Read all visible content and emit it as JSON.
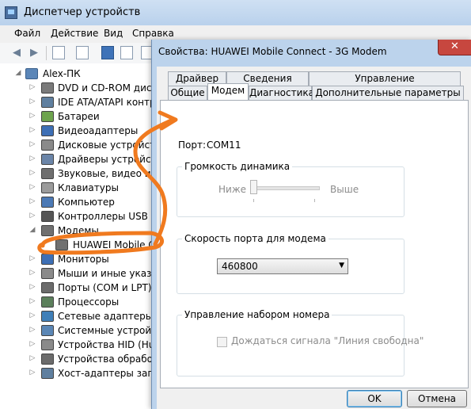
{
  "device_manager": {
    "title": "Диспетчер устройств",
    "menu": [
      "Файл",
      "Действие",
      "Вид",
      "Справка"
    ],
    "tree": {
      "root": "Alex-ПК",
      "items": [
        {
          "label": "DVD и CD-ROM дисково",
          "icon": "dvd-drive-icon",
          "color": "#7a7a7a"
        },
        {
          "label": "IDE ATA/ATAPI контрол",
          "icon": "ide-controller-icon",
          "color": "#5f7f9f"
        },
        {
          "label": "Батареи",
          "icon": "battery-icon",
          "color": "#6da34d"
        },
        {
          "label": "Видеоадаптеры",
          "icon": "display-adapter-icon",
          "color": "#3d6fb5"
        },
        {
          "label": "Дисковые устройства",
          "icon": "disk-drive-icon",
          "color": "#8a8a8a"
        },
        {
          "label": "Драйверы устройств",
          "icon": "driver-icon",
          "color": "#6b85a8"
        },
        {
          "label": "Звуковые, видео и иг",
          "icon": "sound-icon",
          "color": "#6e6e6e"
        },
        {
          "label": "Клавиатуры",
          "icon": "keyboard-icon",
          "color": "#9b9b9b"
        },
        {
          "label": "Компьютер",
          "icon": "computer-icon",
          "color": "#4b79b5"
        },
        {
          "label": "Контроллеры USB",
          "icon": "usb-icon",
          "color": "#555555"
        },
        {
          "label": "Модемы",
          "icon": "modem-icon",
          "color": "#707070"
        },
        {
          "label": "HUAWEI Mobile Co",
          "icon": "modem-device-icon",
          "color": "#707070"
        },
        {
          "label": "Мониторы",
          "icon": "monitor-icon",
          "color": "#3d6fb5"
        },
        {
          "label": "Мыши и иные указыв",
          "icon": "mouse-icon",
          "color": "#8a8a8a"
        },
        {
          "label": "Порты (COM и LPT)",
          "icon": "port-icon",
          "color": "#6b6b6b"
        },
        {
          "label": "Процессоры",
          "icon": "processor-icon",
          "color": "#5b7f5b"
        },
        {
          "label": "Сетевые адаптеры",
          "icon": "network-adapter-icon",
          "color": "#3f7fb8"
        },
        {
          "label": "Системные устройства",
          "icon": "system-device-icon",
          "color": "#5a86b5"
        },
        {
          "label": "Устройства HID (Hum",
          "icon": "hid-icon",
          "color": "#8a8a8a"
        },
        {
          "label": "Устройства обработк",
          "icon": "imaging-device-icon",
          "color": "#6b6b6b"
        },
        {
          "label": "Хост-адаптеры запом",
          "icon": "storage-controller-icon",
          "color": "#5f7f9f"
        }
      ]
    }
  },
  "dialog": {
    "title": "Свойства: HUAWEI Mobile Connect - 3G Modem",
    "close_label": "✕",
    "tabs_row1": [
      "Драйвер",
      "Сведения",
      "Управление электропитанием"
    ],
    "tabs_row2": [
      "Общие",
      "Модем",
      "Диагностика",
      "Дополнительные параметры связи"
    ],
    "active_tab": "Модем",
    "port_label": "Порт:",
    "port_value": "COM11",
    "volume": {
      "title": "Громкость динамика",
      "low_label": "Ниже",
      "high_label": "Выше",
      "level_fraction": 0.0,
      "enabled": false
    },
    "speed": {
      "title": "Скорость порта для модема",
      "selected": "460800"
    },
    "dialing": {
      "title": "Управление набором номера",
      "wait_dialtone_label": "Дождаться сигнала \"Линия свободна\"",
      "checked": false,
      "enabled": false
    },
    "buttons": {
      "ok": "OK",
      "cancel": "Отмена"
    }
  },
  "colors": {
    "annotation": "#f07a1f",
    "dialog_frame": "#bcd3ec",
    "close_button": "#c7473f"
  }
}
